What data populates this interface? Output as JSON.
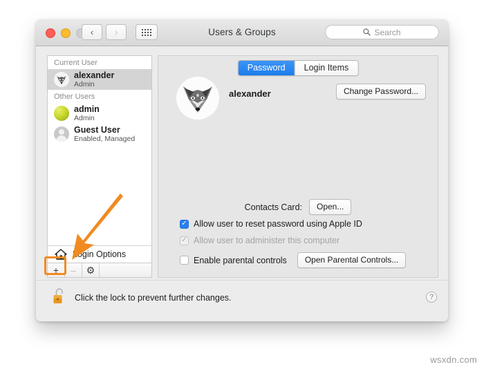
{
  "window": {
    "title": "Users & Groups",
    "traffic_lights": [
      "close",
      "minimize",
      "zoom"
    ],
    "nav": {
      "back": "‹",
      "forward": "›",
      "show_all": "grid-icon"
    },
    "search": {
      "placeholder": "Search",
      "value": "",
      "icon": "search-icon"
    }
  },
  "sidebar": {
    "groups": [
      {
        "header": "Current User",
        "users": [
          {
            "name": "alexander",
            "subtitle": "Admin",
            "avatar": "fox-avatar",
            "selected": true
          }
        ]
      },
      {
        "header": "Other Users",
        "users": [
          {
            "name": "admin",
            "subtitle": "Admin",
            "avatar": "ball-avatar",
            "selected": false
          },
          {
            "name": "Guest User",
            "subtitle": "Enabled, Managed",
            "avatar": "person-avatar",
            "selected": false
          }
        ]
      }
    ],
    "login_options": {
      "label": "Login Options",
      "icon": "home-icon"
    },
    "actions": {
      "add": {
        "label": "+",
        "enabled": true,
        "highlighted": true
      },
      "remove": {
        "label": "–",
        "enabled": false
      },
      "settings": {
        "label": "⚙",
        "icon": "gear-icon",
        "enabled": true
      }
    }
  },
  "content": {
    "tabs": [
      {
        "label": "Password",
        "active": true
      },
      {
        "label": "Login Items",
        "active": false
      }
    ],
    "account": {
      "avatar": "fox-avatar",
      "name": "alexander",
      "change_password_label": "Change Password..."
    },
    "contacts_card": {
      "label": "Contacts Card:",
      "button_label": "Open..."
    },
    "checkboxes": [
      {
        "label": "Allow user to reset password using Apple ID",
        "checked": true,
        "disabled": false
      },
      {
        "label": "Allow user to administer this computer",
        "checked": true,
        "disabled": true
      },
      {
        "label": "Enable parental controls",
        "checked": false,
        "disabled": false
      }
    ],
    "parental_controls_button": "Open Parental Controls..."
  },
  "footer": {
    "lock_icon": "unlocked-padlock-icon",
    "message": "Click the lock to prevent further changes.",
    "help_label": "?"
  },
  "annotations": {
    "arrow": "orange-arrow-pointing-to-add-button",
    "highlight": "orange-box-around-add-button"
  },
  "watermark": "wsxdn.com",
  "colors": {
    "accent_blue": "#2a7ff0",
    "annotation_orange": "#f18a21",
    "window_chrome": "#ececec"
  }
}
